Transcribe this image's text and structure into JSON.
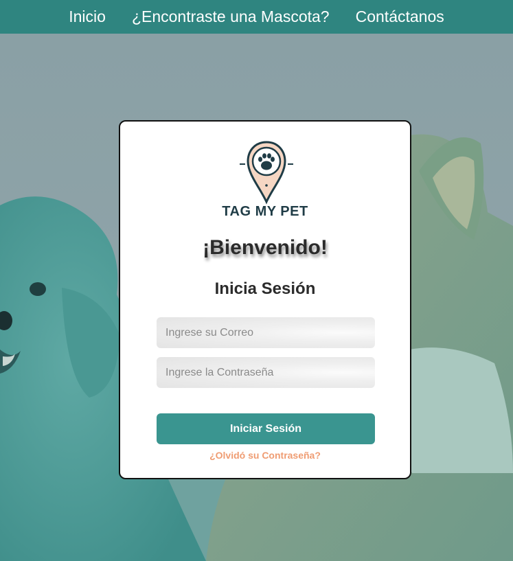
{
  "nav": {
    "items": [
      {
        "label": "Inicio"
      },
      {
        "label": "¿Encontraste una Mascota?"
      },
      {
        "label": "Contáctanos"
      }
    ]
  },
  "login": {
    "brand": "TAG MY PET",
    "welcome": "¡Bienvenido!",
    "subtitle": "Inicia Sesión",
    "email_placeholder": "Ingrese su Correo",
    "email_value": "",
    "password_placeholder": "Ingrese la Contraseña",
    "password_value": "",
    "submit_label": "Iniciar Sesión",
    "forgot_label": "¿Olvidó su Contraseña?"
  },
  "colors": {
    "nav_bg": "#2f8580",
    "button_bg": "#3a9590",
    "forgot_text": "#ef9c72",
    "brand_text": "#1f3c46",
    "overlay": "#3a9590"
  },
  "icons": [
    "paw-location-pin-icon"
  ]
}
